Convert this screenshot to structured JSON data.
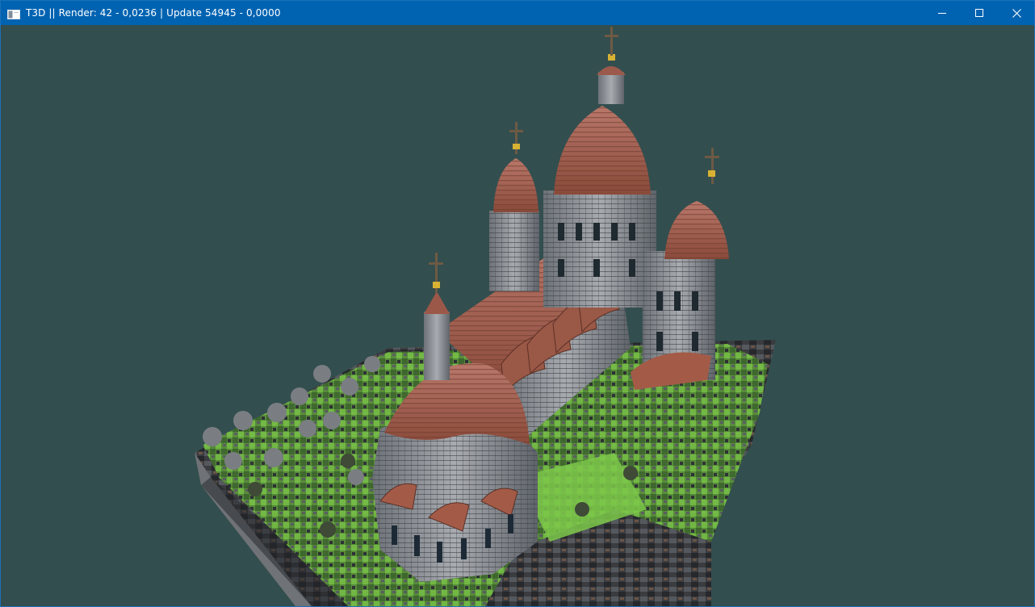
{
  "window": {
    "title": "T3D || Render: 42 - 0,0236 | Update 54945 - 0,0000",
    "icon": "app-window-icon",
    "controls": {
      "minimize": "minimize-icon",
      "maximize": "maximize-icon",
      "close": "close-icon"
    }
  },
  "viewport": {
    "background_color": "#334e4e",
    "subject": "3D voxel cathedral scene"
  },
  "colors": {
    "titlebar": "#0063b1",
    "roof": "#b0624a",
    "stone": "#8a8f96",
    "grass": "#6fbf3c"
  }
}
